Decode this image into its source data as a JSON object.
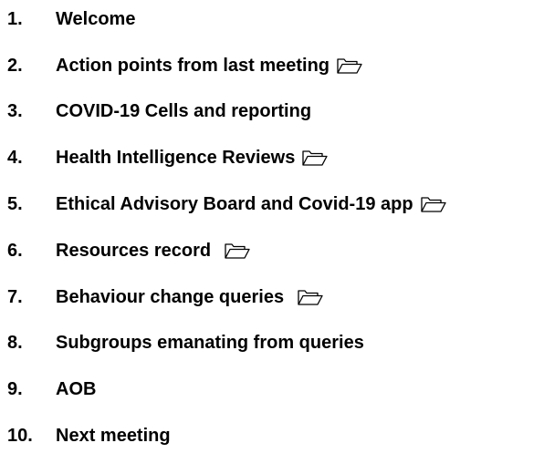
{
  "agenda": {
    "items": [
      {
        "number": "1.",
        "label": "Welcome",
        "icon": null
      },
      {
        "number": "2.",
        "label": "Action points from last meeting",
        "icon": "folder-open-icon"
      },
      {
        "number": "3.",
        "label": "COVID-19 Cells and reporting",
        "icon": null
      },
      {
        "number": "4.",
        "label": "Health Intelligence Reviews",
        "icon": "folder-open-icon"
      },
      {
        "number": "5.",
        "label": "Ethical Advisory Board and Covid-19 app",
        "icon": "folder-open-icon"
      },
      {
        "number": "6.",
        "label": "Resources record",
        "icon": "folder-open-icon"
      },
      {
        "number": "7.",
        "label": "Behaviour change queries",
        "icon": "folder-open-icon"
      },
      {
        "number": "8.",
        "label": "Subgroups emanating from queries",
        "icon": null
      },
      {
        "number": "9.",
        "label": "AOB",
        "icon": null
      },
      {
        "number": "10.",
        "label": "Next meeting",
        "icon": null
      }
    ]
  }
}
